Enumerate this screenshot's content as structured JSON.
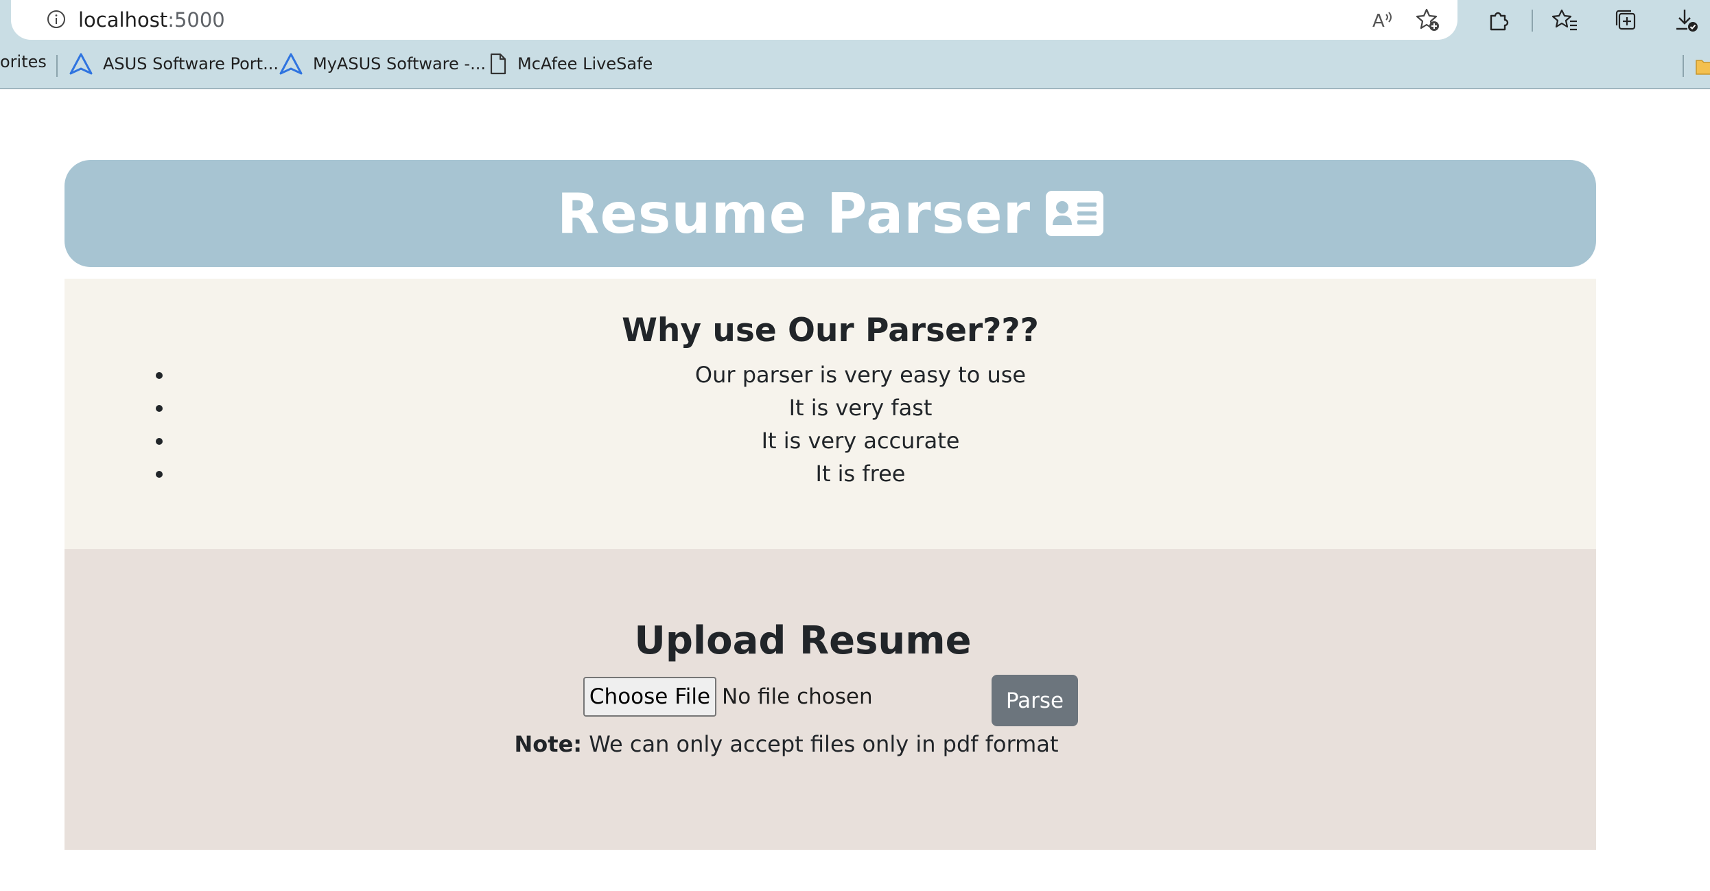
{
  "browser": {
    "url_host": "localhost",
    "url_port": ":5000",
    "bookmarks": [
      {
        "label": "orites",
        "icon": "none"
      },
      {
        "label": "ASUS Software Port...",
        "icon": "asus-logo-icon"
      },
      {
        "label": "MyASUS Software -...",
        "icon": "asus-logo-icon"
      },
      {
        "label": "McAfee LiveSafe",
        "icon": "document-icon"
      }
    ]
  },
  "header": {
    "title": "Resume Parser",
    "icon": "id-card-icon"
  },
  "why": {
    "title": "Why use Our Parser???",
    "items": [
      "Our parser is very easy to use",
      "It is very fast",
      "It is very accurate",
      "It is free"
    ]
  },
  "upload": {
    "title": "Upload Resume",
    "choose_label": "Choose File",
    "no_file": "No file chosen",
    "parse_label": "Parse",
    "note_label": "Note:",
    "note_text": " We can only accept files only in pdf format"
  },
  "colors": {
    "header_bg": "#a7c4d2",
    "why_bg": "#f6f3ec",
    "upload_bg": "#e8e0db",
    "parse_bg": "#6c757d",
    "chrome_bg": "#c9dde4"
  }
}
